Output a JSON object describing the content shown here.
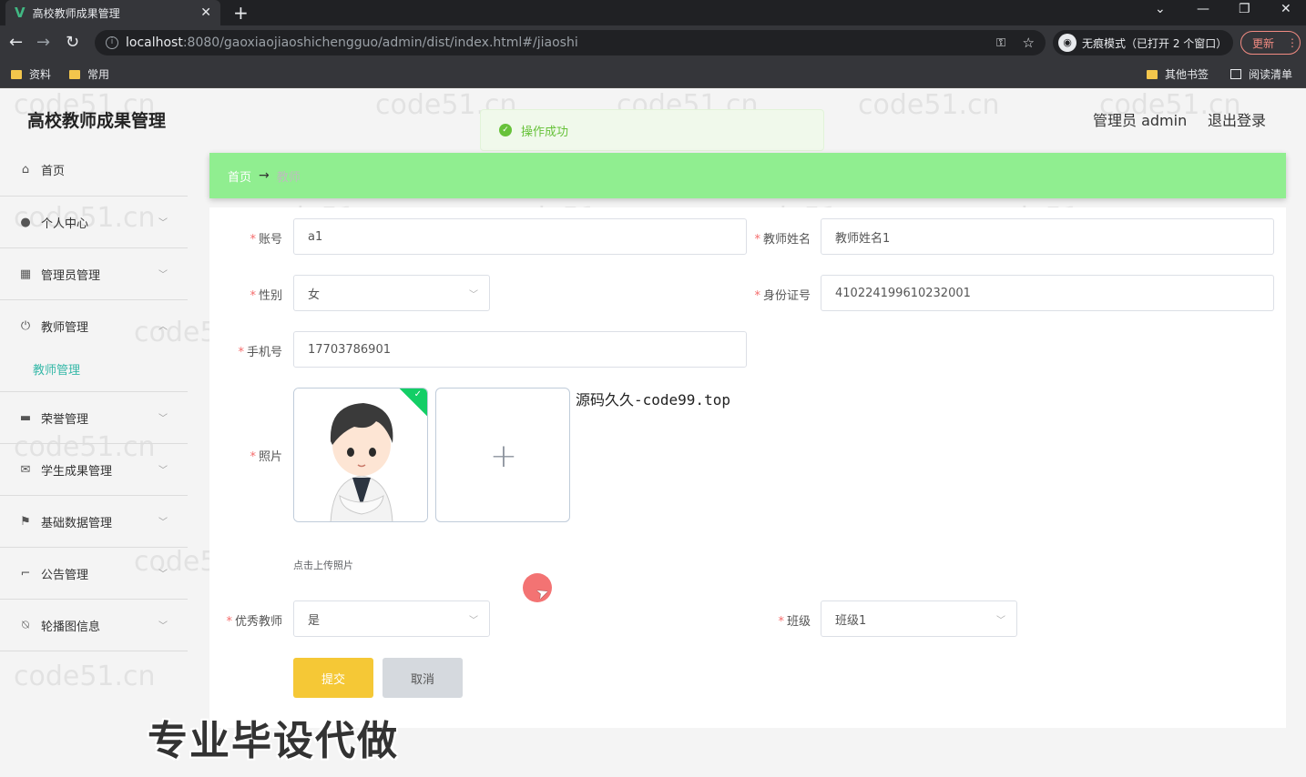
{
  "browser": {
    "tab_title": "高校教师成果管理",
    "url_host": "localhost",
    "url_path": ":8080/gaoxiaojiaoshichengguo/admin/dist/index.html#/jiaoshi",
    "incognito_label": "无痕模式（已打开 2 个窗口）",
    "update_label": "更新",
    "bookmarks": [
      "资料",
      "常用"
    ],
    "bookmarks_right": [
      "其他书签",
      "阅读清单"
    ]
  },
  "app": {
    "title": "高校教师成果管理",
    "user": "管理员 admin",
    "logout": "退出登录"
  },
  "toast": {
    "message": "操作成功"
  },
  "sidebar": {
    "items": [
      {
        "label": "首页",
        "icon": "home-icon",
        "chevron": false
      },
      {
        "label": "个人中心",
        "icon": "person-icon",
        "chevron": true
      },
      {
        "label": "管理员管理",
        "icon": "grid-icon",
        "chevron": true
      },
      {
        "label": "教师管理",
        "icon": "power-icon",
        "chevron": true,
        "expanded": true
      },
      {
        "label": "荣誉管理",
        "icon": "board-icon",
        "chevron": true
      },
      {
        "label": "学生成果管理",
        "icon": "mail-icon",
        "chevron": true
      },
      {
        "label": "基础数据管理",
        "icon": "flag-icon",
        "chevron": true
      },
      {
        "label": "公告管理",
        "icon": "crop-icon",
        "chevron": true
      },
      {
        "label": "轮播图信息",
        "icon": "bell-off-icon",
        "chevron": true
      }
    ],
    "sub_item": "教师管理"
  },
  "breadcrumb": {
    "home": "首页",
    "arrow": "→",
    "current": "教师"
  },
  "form": {
    "account_label": "账号",
    "account_value": "a1",
    "name_label": "教师姓名",
    "name_value": "教师姓名1",
    "gender_label": "性别",
    "gender_value": "女",
    "idcard_label": "身份证号",
    "idcard_value": "410224199610232001",
    "phone_label": "手机号",
    "phone_value": "17703786901",
    "photo_label": "照片",
    "upload_tip": "点击上传照片",
    "excellent_label": "优秀教师",
    "excellent_value": "是",
    "class_label": "班级",
    "class_value": "班级1",
    "submit": "提交",
    "cancel": "取消"
  },
  "overlay": {
    "code99": "源码久久-code99.top",
    "promo": "专业毕设代做",
    "watermark": "code51.cn"
  },
  "colors": {
    "breadcrumb_bg": "#90ee90",
    "submit_bg": "#f5c836",
    "sub_item": "#36b8a8",
    "toast": "#67c23a"
  }
}
